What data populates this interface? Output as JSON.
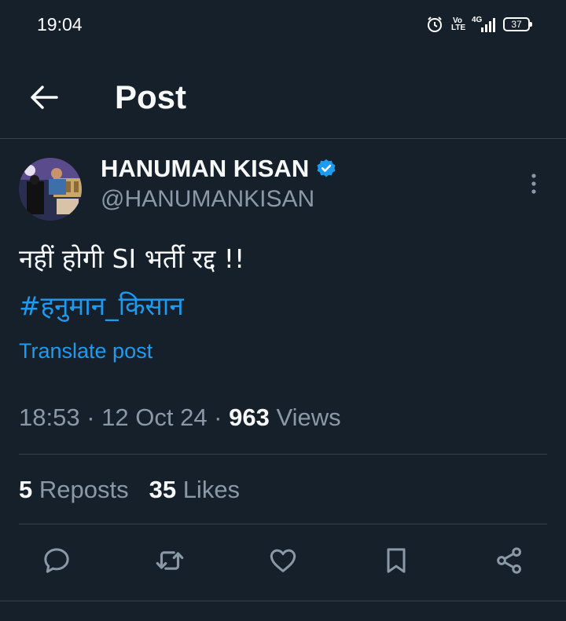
{
  "status_bar": {
    "time": "19:04",
    "volte_top": "Vo",
    "volte_bottom": "LTE",
    "network": "4G",
    "battery": "37",
    "icons": [
      "alarm-icon",
      "volte-icon",
      "signal-icon",
      "battery-icon"
    ]
  },
  "header": {
    "title": "Post",
    "back_icon": "arrow-left-icon"
  },
  "author": {
    "name": "HANUMAN KISAN",
    "handle": "@HANUMANKISAN",
    "verified": true,
    "more_icon": "more-vertical-icon"
  },
  "post": {
    "text": "नहीं होगी SI भर्ती रद्द !!",
    "hashtag": "#हनुमान_किसान",
    "translate_label": "Translate post"
  },
  "meta": {
    "time": "18:53",
    "sep1": " · ",
    "date": "12 Oct 24",
    "sep2": " · ",
    "views_count": "963",
    "views_label": " Views"
  },
  "stats": {
    "reposts_count": "5",
    "reposts_label": " Reposts",
    "likes_count": "35",
    "likes_label": " Likes"
  },
  "actions": [
    "reply-icon",
    "repost-icon",
    "like-icon",
    "bookmark-icon",
    "share-icon"
  ],
  "colors": {
    "background": "#15202b",
    "accent": "#1d9bf0",
    "secondary_text": "#8b98a5",
    "divider": "#38444d"
  }
}
